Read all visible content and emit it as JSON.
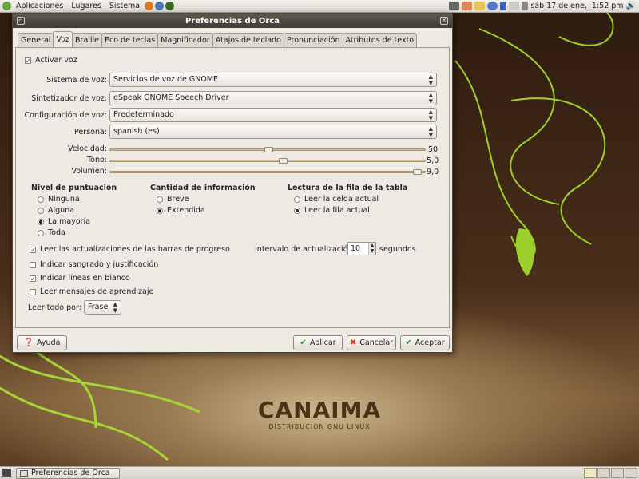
{
  "top_panel": {
    "menus": [
      "Aplicaciones",
      "Lugares",
      "Sistema"
    ],
    "clock": "sáb 17 de ene,  1:52 pm"
  },
  "window": {
    "title": "Preferencias de Orca",
    "tabs": [
      "General",
      "Voz",
      "Braille",
      "Eco de teclas",
      "Magnificador",
      "Atajos de teclado",
      "Pronunciación",
      "Atributos de texto"
    ],
    "active_tab": "Voz",
    "enable_speech": {
      "label": "Activar voz",
      "checked": true
    },
    "speech_system": {
      "label": "Sistema de voz:",
      "value": "Servicios de voz de GNOME"
    },
    "speech_synth": {
      "label": "Sintetizador de voz:",
      "value": "eSpeak GNOME Speech Driver"
    },
    "voice_settings": {
      "label": "Configuración de voz:",
      "value": "Predeterminado"
    },
    "person": {
      "label": "Persona:",
      "value": "spanish (es)"
    },
    "rate": {
      "label": "Velocidad:",
      "value": "50",
      "fraction": 0.5
    },
    "pitch": {
      "label": "Tono:",
      "value": "5,0",
      "fraction": 0.5
    },
    "volume": {
      "label": "Volumen:",
      "value": "9,0",
      "fraction": 0.9
    },
    "punctuation": {
      "title": "Nivel de puntuación",
      "options": [
        "Ninguna",
        "Alguna",
        "La mayoría",
        "Toda"
      ],
      "selected": "La mayoría"
    },
    "verbosity": {
      "title": "Cantidad de información",
      "options": [
        "Breve",
        "Extendida"
      ],
      "selected": "Extendida"
    },
    "table_rows": {
      "title": "Lectura de la fila de la tabla",
      "options": [
        "Leer la celda actual",
        "Leer la fila actual"
      ],
      "selected": "Leer la fila actual"
    },
    "checks": {
      "progress_updates": {
        "label": "Leer las actualizaciones de las barras de progreso",
        "checked": true
      },
      "indentation": {
        "label": "Indicar sangrado y justificación",
        "checked": false
      },
      "blank_lines": {
        "label": "Indicar líneas en blanco",
        "checked": true
      },
      "tutorial": {
        "label": "Leer mensajes de aprendizaje",
        "checked": false
      }
    },
    "update_interval": {
      "label": "Intervalo de actualización:",
      "value": "10",
      "unit": "segundos"
    },
    "say_all_by": {
      "label": "Leer todo por:",
      "value": "Frase"
    },
    "buttons": {
      "help": "Ayuda",
      "apply": "Aplicar",
      "cancel": "Cancelar",
      "ok": "Aceptar"
    }
  },
  "desktop": {
    "logo_title": "CANAIMA",
    "logo_subtitle": "DISTRIBUCIÓN GNU LINUX"
  },
  "bottom_panel": {
    "task": "Preferencias de Orca"
  }
}
